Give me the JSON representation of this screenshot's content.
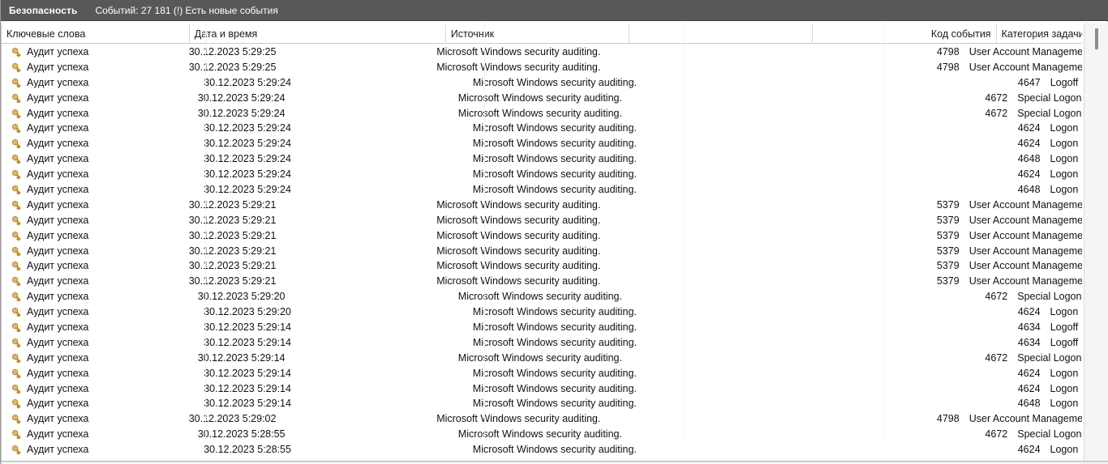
{
  "window": {
    "title": "Безопасность",
    "status": "Событий: 27 181 (!) Есть новые события"
  },
  "colors": {
    "caption_bg": "#58585a",
    "caption_fg": "#ffffff",
    "row_fg": "#111111",
    "key_icon_gold": "#d9a62e",
    "grid_line": "#d6d6d6",
    "scrollbar_thumb": "#8d8d8d"
  },
  "table": {
    "columns": [
      {
        "key": "keywords",
        "label": "Ключевые слова",
        "align": "left"
      },
      {
        "key": "datetime",
        "label": "Дата и время",
        "align": "left"
      },
      {
        "key": "source",
        "label": "Источник",
        "align": "left"
      },
      {
        "key": "spacer",
        "label": "",
        "align": "left"
      },
      {
        "key": "event_id",
        "label": "Код события",
        "align": "right"
      },
      {
        "key": "task_category",
        "label": "Категория задачи",
        "align": "left"
      }
    ],
    "row_icon": "key-audit-success-icon",
    "rows": [
      {
        "keywords": "Аудит успеха",
        "datetime": "30.12.2023 5:29:25",
        "source": "Microsoft Windows security auditing.",
        "event_id": "4798",
        "task_category": "User Account Management"
      },
      {
        "keywords": "Аудит успеха",
        "datetime": "30.12.2023 5:29:25",
        "source": "Microsoft Windows security auditing.",
        "event_id": "4798",
        "task_category": "User Account Management"
      },
      {
        "keywords": "Аудит успеха",
        "datetime": "30.12.2023 5:29:24",
        "source": "Microsoft Windows security auditing.",
        "event_id": "4647",
        "task_category": "Logoff"
      },
      {
        "keywords": "Аудит успеха",
        "datetime": "30.12.2023 5:29:24",
        "source": "Microsoft Windows security auditing.",
        "event_id": "4672",
        "task_category": "Special Logon"
      },
      {
        "keywords": "Аудит успеха",
        "datetime": "30.12.2023 5:29:24",
        "source": "Microsoft Windows security auditing.",
        "event_id": "4672",
        "task_category": "Special Logon"
      },
      {
        "keywords": "Аудит успеха",
        "datetime": "30.12.2023 5:29:24",
        "source": "Microsoft Windows security auditing.",
        "event_id": "4624",
        "task_category": "Logon"
      },
      {
        "keywords": "Аудит успеха",
        "datetime": "30.12.2023 5:29:24",
        "source": "Microsoft Windows security auditing.",
        "event_id": "4624",
        "task_category": "Logon"
      },
      {
        "keywords": "Аудит успеха",
        "datetime": "30.12.2023 5:29:24",
        "source": "Microsoft Windows security auditing.",
        "event_id": "4648",
        "task_category": "Logon"
      },
      {
        "keywords": "Аудит успеха",
        "datetime": "30.12.2023 5:29:24",
        "source": "Microsoft Windows security auditing.",
        "event_id": "4624",
        "task_category": "Logon"
      },
      {
        "keywords": "Аудит успеха",
        "datetime": "30.12.2023 5:29:24",
        "source": "Microsoft Windows security auditing.",
        "event_id": "4648",
        "task_category": "Logon"
      },
      {
        "keywords": "Аудит успеха",
        "datetime": "30.12.2023 5:29:21",
        "source": "Microsoft Windows security auditing.",
        "event_id": "5379",
        "task_category": "User Account Management"
      },
      {
        "keywords": "Аудит успеха",
        "datetime": "30.12.2023 5:29:21",
        "source": "Microsoft Windows security auditing.",
        "event_id": "5379",
        "task_category": "User Account Management"
      },
      {
        "keywords": "Аудит успеха",
        "datetime": "30.12.2023 5:29:21",
        "source": "Microsoft Windows security auditing.",
        "event_id": "5379",
        "task_category": "User Account Management"
      },
      {
        "keywords": "Аудит успеха",
        "datetime": "30.12.2023 5:29:21",
        "source": "Microsoft Windows security auditing.",
        "event_id": "5379",
        "task_category": "User Account Management"
      },
      {
        "keywords": "Аудит успеха",
        "datetime": "30.12.2023 5:29:21",
        "source": "Microsoft Windows security auditing.",
        "event_id": "5379",
        "task_category": "User Account Management"
      },
      {
        "keywords": "Аудит успеха",
        "datetime": "30.12.2023 5:29:21",
        "source": "Microsoft Windows security auditing.",
        "event_id": "5379",
        "task_category": "User Account Management"
      },
      {
        "keywords": "Аудит успеха",
        "datetime": "30.12.2023 5:29:20",
        "source": "Microsoft Windows security auditing.",
        "event_id": "4672",
        "task_category": "Special Logon"
      },
      {
        "keywords": "Аудит успеха",
        "datetime": "30.12.2023 5:29:20",
        "source": "Microsoft Windows security auditing.",
        "event_id": "4624",
        "task_category": "Logon"
      },
      {
        "keywords": "Аудит успеха",
        "datetime": "30.12.2023 5:29:14",
        "source": "Microsoft Windows security auditing.",
        "event_id": "4634",
        "task_category": "Logoff"
      },
      {
        "keywords": "Аудит успеха",
        "datetime": "30.12.2023 5:29:14",
        "source": "Microsoft Windows security auditing.",
        "event_id": "4634",
        "task_category": "Logoff"
      },
      {
        "keywords": "Аудит успеха",
        "datetime": "30.12.2023 5:29:14",
        "source": "Microsoft Windows security auditing.",
        "event_id": "4672",
        "task_category": "Special Logon"
      },
      {
        "keywords": "Аудит успеха",
        "datetime": "30.12.2023 5:29:14",
        "source": "Microsoft Windows security auditing.",
        "event_id": "4624",
        "task_category": "Logon"
      },
      {
        "keywords": "Аудит успеха",
        "datetime": "30.12.2023 5:29:14",
        "source": "Microsoft Windows security auditing.",
        "event_id": "4624",
        "task_category": "Logon"
      },
      {
        "keywords": "Аудит успеха",
        "datetime": "30.12.2023 5:29:14",
        "source": "Microsoft Windows security auditing.",
        "event_id": "4648",
        "task_category": "Logon"
      },
      {
        "keywords": "Аудит успеха",
        "datetime": "30.12.2023 5:29:02",
        "source": "Microsoft Windows security auditing.",
        "event_id": "4798",
        "task_category": "User Account Management"
      },
      {
        "keywords": "Аудит успеха",
        "datetime": "30.12.2023 5:28:55",
        "source": "Microsoft Windows security auditing.",
        "event_id": "4672",
        "task_category": "Special Logon"
      },
      {
        "keywords": "Аудит успеха",
        "datetime": "30.12.2023 5:28:55",
        "source": "Microsoft Windows security auditing.",
        "event_id": "4624",
        "task_category": "Logon"
      }
    ]
  },
  "scrollbar": {
    "orientation": "vertical",
    "thumb_position_percent": 1
  }
}
